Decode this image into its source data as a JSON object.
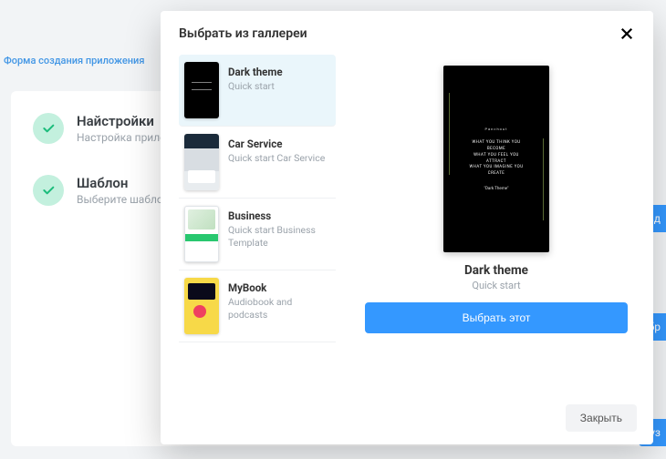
{
  "background": {
    "breadcrumb": "Форма создания приложения",
    "step1_title": "Найстройки",
    "step1_sub": "Настройка приложения",
    "step2_title": "Шаблон",
    "step2_sub": "Выберите шаблон",
    "btn1": "озд",
    "btn2": "ыбр",
    "btn3": "руз"
  },
  "modal": {
    "title": "Выбрать из галлереи",
    "close_label": "Закрыть",
    "select_label": "Выбрать этот",
    "items": [
      {
        "title": "Dark theme",
        "sub": "Quick start"
      },
      {
        "title": "Car Service",
        "sub": "Quick start Car Service"
      },
      {
        "title": "Business",
        "sub": "Quick start Business Template"
      },
      {
        "title": "MyBook",
        "sub": "Audiobook and podcasts"
      }
    ],
    "preview": {
      "title": "Dark theme",
      "sub": "Quick start",
      "brand": "Panchout",
      "quote_l1": "WHAT YOU THINK YOU",
      "quote_l2": "BECOME",
      "quote_l3": "WHAT YOU FEEL YOU",
      "quote_l4": "ATTRACT",
      "quote_l5": "WHAT YOU IMAGINE YOU",
      "quote_l6": "CREATE",
      "author": "\"Dark Theme\""
    }
  }
}
